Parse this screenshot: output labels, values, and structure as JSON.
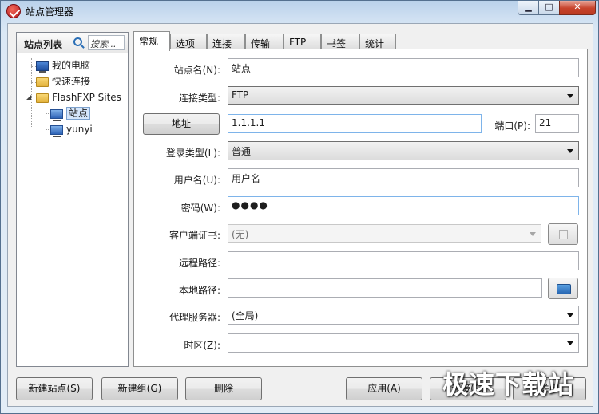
{
  "window": {
    "title": "站点管理器",
    "min": "▁",
    "max": "□",
    "close": "✕"
  },
  "sidebar": {
    "title": "站点列表",
    "search_placeholder": "搜索...",
    "tree": {
      "my_computer": "我的电脑",
      "quick_connect": "快速连接",
      "flashfxp_sites": "FlashFXP Sites",
      "site": "站点",
      "yunyi": "yunyi"
    }
  },
  "tabs": [
    "常规",
    "选项",
    "连接",
    "传输",
    "FTP",
    "书签",
    "统计"
  ],
  "form": {
    "site_name": {
      "label": "站点名(N):",
      "value": "站点"
    },
    "conn_type": {
      "label": "连接类型:",
      "value": "FTP"
    },
    "address": {
      "button": "地址",
      "value": "1.1.1.1"
    },
    "port": {
      "label": "端口(P):",
      "value": "21"
    },
    "login_type": {
      "label": "登录类型(L):",
      "value": "普通"
    },
    "username": {
      "label": "用户名(U):",
      "value": "用户名"
    },
    "password": {
      "label": "密码(W):",
      "value": "●●●●"
    },
    "client_cert": {
      "label": "客户端证书:",
      "value": "(无)"
    },
    "remote_path": {
      "label": "远程路径:",
      "value": ""
    },
    "local_path": {
      "label": "本地路径:",
      "value": ""
    },
    "proxy": {
      "label": "代理服务器:",
      "value": "(全局)"
    },
    "timezone": {
      "label": "时区(Z):",
      "value": ""
    }
  },
  "buttons": {
    "new_site": "新建站点(S)",
    "new_group": "新建组(G)",
    "delete": "删除",
    "apply": "应用(A)",
    "connect": "连接(C)",
    "close": "关闭"
  },
  "watermark": "极速下载站"
}
